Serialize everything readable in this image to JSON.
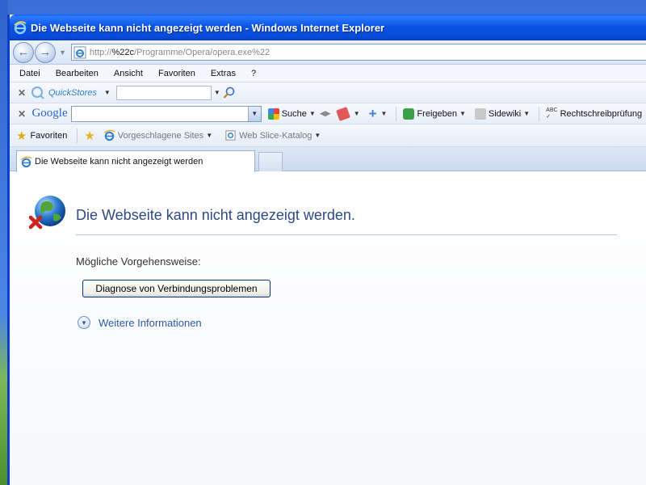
{
  "window": {
    "title": "Die Webseite kann nicht angezeigt werden - Windows Internet Explorer"
  },
  "nav": {
    "url_prefix": "http://",
    "url_host": "%22c",
    "url_path": "/Programme/Opera/opera.exe%22"
  },
  "menu": {
    "items": [
      "Datei",
      "Bearbeiten",
      "Ansicht",
      "Favoriten",
      "Extras",
      "?"
    ]
  },
  "quickstores": {
    "logo_text": "QuickStores",
    "search_value": ""
  },
  "google_toolbar": {
    "logo_text": "Google",
    "search_value": "",
    "suche_label": "Suche",
    "freigeben_label": "Freigeben",
    "sidewiki_label": "Sidewiki",
    "spell_label": "Rechtschreibprüfung"
  },
  "favorites_bar": {
    "favoriten_label": "Favoriten",
    "suggested_label": "Vorgeschlagene Sites",
    "webslice_label": "Web Slice-Katalog"
  },
  "tabs": {
    "active_label": "Die Webseite kann nicht angezeigt werden"
  },
  "content": {
    "error_title": "Die Webseite kann nicht angezeigt werden.",
    "subhead": "Mögliche Vorgehensweise:",
    "diagnose_button": "Diagnose von Verbindungsproblemen",
    "more_info": "Weitere Informationen"
  },
  "colors": {
    "titlebar": "#0b55e6",
    "error_title": "#2e4a82",
    "link": "#2a5aa8"
  }
}
